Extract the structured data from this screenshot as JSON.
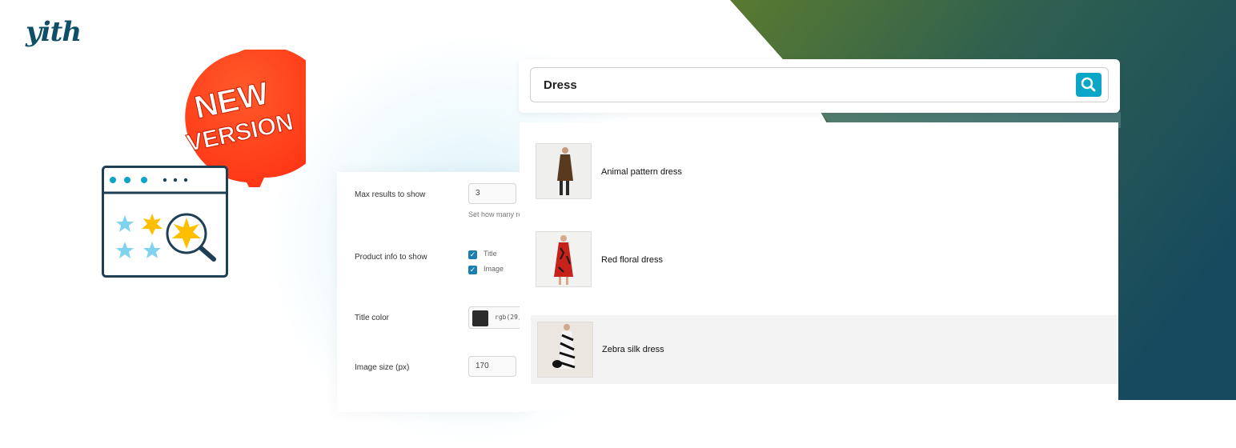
{
  "brand": {
    "logo_text": "yith"
  },
  "badge": {
    "line1": "NEW",
    "line2": "VERSION",
    "color": "#ff3b1f"
  },
  "colors": {
    "accent": "#0aa5c7",
    "checkbox": "#1a7fb0",
    "star_blue": "#7fd3ee",
    "star_yellow": "#ffbe00",
    "dark_teal": "#174a5e",
    "green": "#5a7a30"
  },
  "settings": {
    "max_results": {
      "label": "Max results to show",
      "value": "3",
      "hint": "Set how many re"
    },
    "product_info": {
      "label": "Product info to show",
      "options": [
        {
          "label": "Title",
          "checked": true
        },
        {
          "label": "Image",
          "checked": true
        }
      ]
    },
    "title_color": {
      "label": "Title color",
      "value": "rgb(29,..."
    },
    "image_size": {
      "label": "Image size (px)",
      "value": "170"
    }
  },
  "search": {
    "query": "Dress",
    "icon": "search-icon"
  },
  "results": [
    {
      "title": "Animal pattern dress",
      "highlighted": false
    },
    {
      "title": "Red floral dress",
      "highlighted": false
    },
    {
      "title": "Zebra silk dress",
      "highlighted": true
    }
  ]
}
